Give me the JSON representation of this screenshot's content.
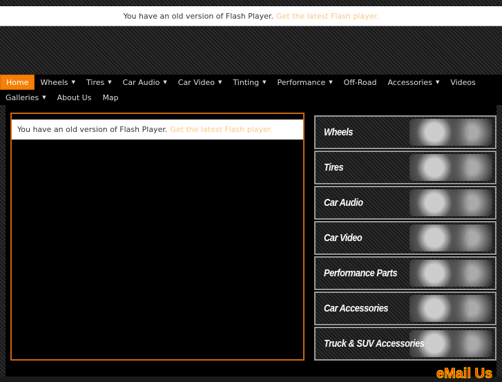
{
  "flash_notice": {
    "text": "You have an old version of Flash Player.",
    "link": "Get the latest Flash player."
  },
  "nav": [
    {
      "label": "Home",
      "active": true,
      "dropdown": false
    },
    {
      "label": "Wheels",
      "dropdown": true
    },
    {
      "label": "Tires",
      "dropdown": true
    },
    {
      "label": "Car Audio",
      "dropdown": true
    },
    {
      "label": "Car Video",
      "dropdown": true
    },
    {
      "label": "Tinting",
      "dropdown": true
    },
    {
      "label": "Performance",
      "dropdown": true
    },
    {
      "label": "Off-Road",
      "dropdown": false
    },
    {
      "label": "Accessories",
      "dropdown": true
    },
    {
      "label": "Videos",
      "dropdown": false
    },
    {
      "label": "Galleries",
      "dropdown": true
    },
    {
      "label": "About Us",
      "dropdown": false
    },
    {
      "label": "Map",
      "dropdown": false
    }
  ],
  "categories": [
    "Wheels",
    "Tires",
    "Car Audio",
    "Car Video",
    "Performance  Parts",
    "Car Accessories",
    "Truck & SUV Accessories"
  ],
  "email_button": "eMail Us",
  "colors": {
    "accent": "#f57f07",
    "link": "#f5c987"
  }
}
